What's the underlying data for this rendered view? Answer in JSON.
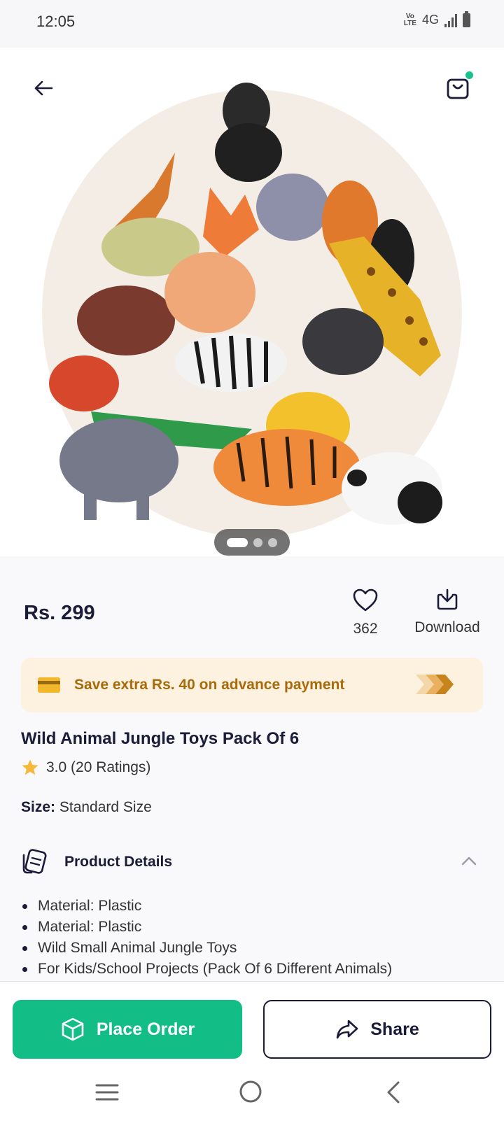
{
  "status_bar": {
    "time": "12:05",
    "volte": "Vo LTE",
    "network": "4G"
  },
  "hero": {
    "back_icon": "arrow-left-icon",
    "cart_icon": "shopping-bag-icon",
    "image_alt": "Assorted plastic wild animal toys",
    "slides_total": 3,
    "slide_active": 1
  },
  "product": {
    "price": "Rs. 299",
    "wishlist_count": "362",
    "download_label": "Download",
    "offer_text": "Save extra Rs. 40 on advance payment",
    "title": "Wild Animal Jungle Toys Pack Of 6",
    "rating_text": "3.0 (20 Ratings)",
    "size_label": "Size:",
    "size_value": "Standard Size"
  },
  "details": {
    "heading": "Product Details",
    "items": [
      "Material: Plastic",
      "Material: Plastic",
      "Wild Small Animal Jungle Toys",
      "For Kids/School Projects (Pack Of 6 Different Animals)"
    ]
  },
  "actions": {
    "place_order": "Place Order",
    "share": "Share"
  },
  "colors": {
    "accent_green": "#12bd86",
    "brand_navy": "#1b1b3a",
    "offer_bg": "#fdf1e0",
    "offer_text": "#a86a0a"
  }
}
